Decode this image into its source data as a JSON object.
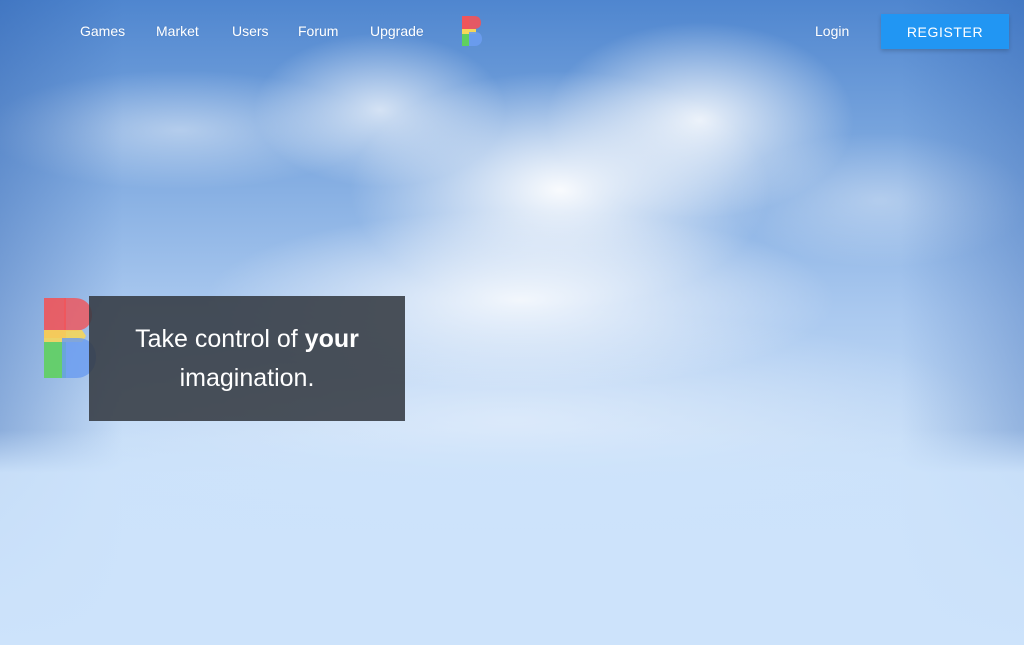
{
  "nav": {
    "links": [
      {
        "label": "Games"
      },
      {
        "label": "Market"
      },
      {
        "label": "Users"
      },
      {
        "label": "Forum"
      },
      {
        "label": "Upgrade"
      }
    ],
    "login_label": "Login",
    "register_label": "REGISTER",
    "logo_icon": "b-logo-icon"
  },
  "hero": {
    "text_before": "Take control of ",
    "text_emphasis": "your",
    "text_after": " imagination.",
    "logo_icon": "b-logo-icon"
  },
  "colors": {
    "register_button": "#2196f3",
    "hero_card": "#343a42",
    "logo_red": "#f0555a",
    "logo_yellow": "#f5d65a",
    "logo_green": "#5fd05f",
    "logo_blue": "#6a9cf0",
    "sky_top": "#4f86cf",
    "sky_bottom": "#cfe4fb"
  }
}
